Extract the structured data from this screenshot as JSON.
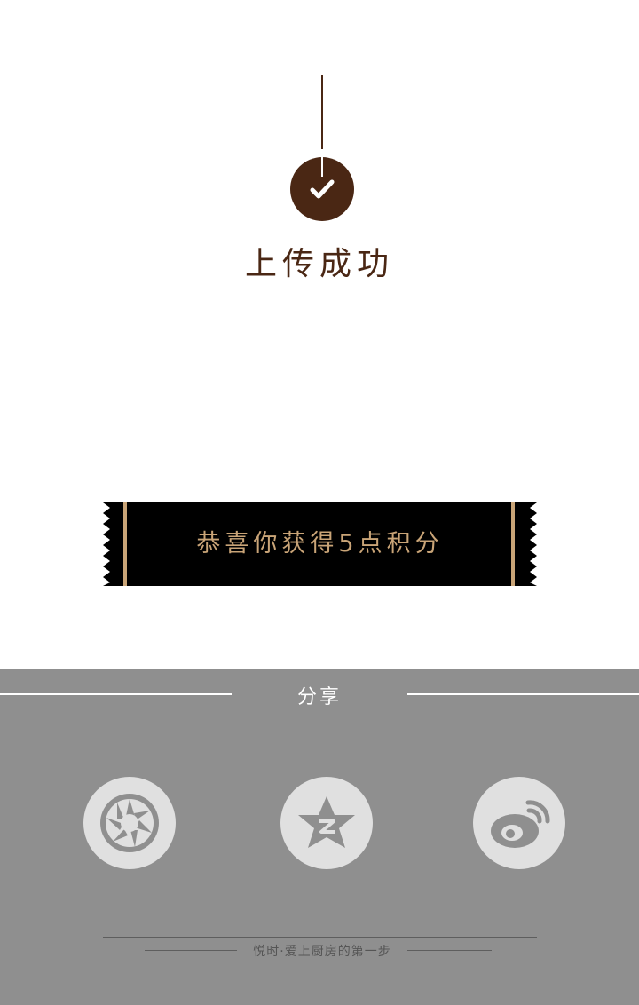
{
  "header": {
    "title": "上传成功",
    "badge_icon": "check-icon",
    "accent_color": "#4a2714"
  },
  "reward": {
    "text": "恭喜你获得5点积分",
    "text_color": "#c9a477",
    "ribbon_color": "#000000"
  },
  "share": {
    "title": "分享",
    "panel_color": "#8f8f8f",
    "buttons": [
      {
        "name": "moments",
        "icon": "camera-aperture-icon"
      },
      {
        "name": "qzone",
        "icon": "qzone-star-icon"
      },
      {
        "name": "weibo",
        "icon": "weibo-icon"
      }
    ]
  },
  "footer": {
    "slogan": "悦时·爱上厨房的第一步"
  }
}
